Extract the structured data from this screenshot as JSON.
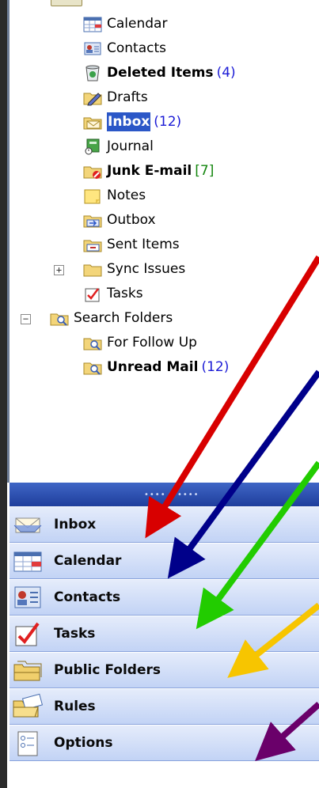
{
  "folders": {
    "calendar": {
      "label": "Calendar"
    },
    "contacts": {
      "label": "Contacts"
    },
    "deleted_items": {
      "label": "Deleted Items",
      "count": "(4)"
    },
    "drafts": {
      "label": "Drafts"
    },
    "inbox": {
      "label": "Inbox",
      "count": "(12)"
    },
    "journal": {
      "label": "Journal"
    },
    "junk": {
      "label": "Junk E-mail",
      "count": "[7]"
    },
    "notes": {
      "label": "Notes"
    },
    "outbox": {
      "label": "Outbox"
    },
    "sent_items": {
      "label": "Sent Items"
    },
    "sync_issues": {
      "label": "Sync Issues"
    },
    "tasks": {
      "label": "Tasks"
    },
    "search_folders": {
      "label": "Search Folders"
    },
    "for_follow_up": {
      "label": "For Follow Up"
    },
    "unread_mail": {
      "label": "Unread Mail",
      "count": "(12)"
    }
  },
  "expanders": {
    "sync_issues": "+",
    "search_folders": "−"
  },
  "splitter": {
    "grip": "•••• ▾ ••••"
  },
  "nav": {
    "inbox": "Inbox",
    "calendar": "Calendar",
    "contacts": "Contacts",
    "tasks": "Tasks",
    "public_folders": "Public Folders",
    "rules": "Rules",
    "options": "Options"
  },
  "icons": {
    "calendar": "calendar-icon",
    "contacts": "contacts-icon",
    "deleted": "trash-icon",
    "drafts": "drafts-folder-icon",
    "inbox": "inbox-folder-icon",
    "journal": "journal-icon",
    "junk": "junk-folder-icon",
    "notes": "notes-icon",
    "outbox": "outbox-folder-icon",
    "sent": "sent-folder-icon",
    "sync": "folder-icon",
    "tasks": "tasks-icon",
    "search": "search-folder-icon"
  },
  "colors": {
    "selection": "#2b57c7",
    "count_blue": "#1c1cd6",
    "count_green": "#13860e",
    "arrow_red": "#d80000",
    "arrow_navy": "#00008a",
    "arrow_green": "#22cc00",
    "arrow_yellow": "#f7c500",
    "arrow_purple": "#6a006a"
  }
}
